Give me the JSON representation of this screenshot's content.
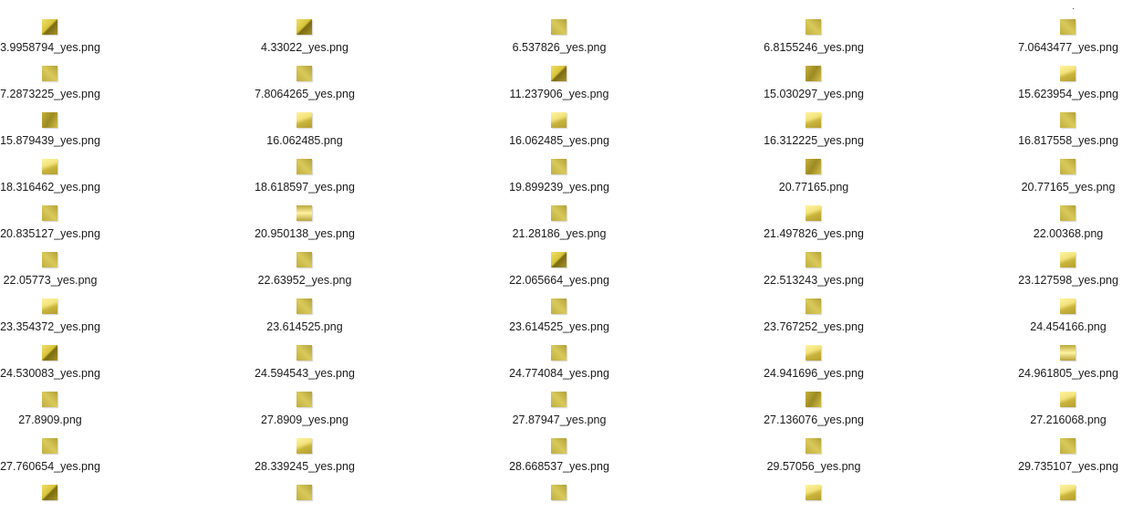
{
  "files": [
    {
      "name": "3.9958794_yes.png",
      "thumb": 0
    },
    {
      "name": "4.33022_yes.png",
      "thumb": 0
    },
    {
      "name": "6.537826_yes.png",
      "thumb": 1
    },
    {
      "name": "6.8155246_yes.png",
      "thumb": 1
    },
    {
      "name": "7.0643477_yes.png",
      "thumb": 1
    },
    {
      "name": "7.2873225_yes.png",
      "thumb": 1
    },
    {
      "name": "7.8064265_yes.png",
      "thumb": 1
    },
    {
      "name": "11.237906_yes.png",
      "thumb": 0
    },
    {
      "name": "15.030297_yes.png",
      "thumb": 3
    },
    {
      "name": "15.623954_yes.png",
      "thumb": 2
    },
    {
      "name": "15.879439_yes.png",
      "thumb": 3
    },
    {
      "name": "16.062485.png",
      "thumb": 2
    },
    {
      "name": "16.062485_yes.png",
      "thumb": 2
    },
    {
      "name": "16.312225_yes.png",
      "thumb": 2
    },
    {
      "name": "16.817558_yes.png",
      "thumb": 1
    },
    {
      "name": "18.316462_yes.png",
      "thumb": 2
    },
    {
      "name": "18.618597_yes.png",
      "thumb": 1
    },
    {
      "name": "19.899239_yes.png",
      "thumb": 1
    },
    {
      "name": "20.77165.png",
      "thumb": 3
    },
    {
      "name": "20.77165_yes.png",
      "thumb": 1
    },
    {
      "name": "20.835127_yes.png",
      "thumb": 1
    },
    {
      "name": "20.950138_yes.png",
      "thumb": 4
    },
    {
      "name": "21.28186_yes.png",
      "thumb": 1
    },
    {
      "name": "21.497826_yes.png",
      "thumb": 2
    },
    {
      "name": "22.00368.png",
      "thumb": 1
    },
    {
      "name": "22.05773_yes.png",
      "thumb": 1
    },
    {
      "name": "22.63952_yes.png",
      "thumb": 1
    },
    {
      "name": "22.065664_yes.png",
      "thumb": 0
    },
    {
      "name": "22.513243_yes.png",
      "thumb": 1
    },
    {
      "name": "23.127598_yes.png",
      "thumb": 2
    },
    {
      "name": "23.354372_yes.png",
      "thumb": 2
    },
    {
      "name": "23.614525.png",
      "thumb": 1
    },
    {
      "name": "23.614525_yes.png",
      "thumb": 1
    },
    {
      "name": "23.767252_yes.png",
      "thumb": 1
    },
    {
      "name": "24.454166.png",
      "thumb": 2
    },
    {
      "name": "24.530083_yes.png",
      "thumb": 0
    },
    {
      "name": "24.594543_yes.png",
      "thumb": 1
    },
    {
      "name": "24.774084_yes.png",
      "thumb": 1
    },
    {
      "name": "24.941696_yes.png",
      "thumb": 2
    },
    {
      "name": "24.961805_yes.png",
      "thumb": 4
    },
    {
      "name": "27.8909.png",
      "thumb": 1
    },
    {
      "name": "27.8909_yes.png",
      "thumb": 1
    },
    {
      "name": "27.87947_yes.png",
      "thumb": 1
    },
    {
      "name": "27.136076_yes.png",
      "thumb": 3
    },
    {
      "name": "27.216068.png",
      "thumb": 2
    },
    {
      "name": "27.760654_yes.png",
      "thumb": 1
    },
    {
      "name": "28.339245_yes.png",
      "thumb": 2
    },
    {
      "name": "28.668537_yes.png",
      "thumb": 1
    },
    {
      "name": "29.57056_yes.png",
      "thumb": 1
    },
    {
      "name": "29.735107_yes.png",
      "thumb": 1
    },
    {
      "name": "",
      "thumb": 0
    },
    {
      "name": "",
      "thumb": 1
    },
    {
      "name": "",
      "thumb": 1
    },
    {
      "name": "",
      "thumb": 2
    },
    {
      "name": "",
      "thumb": 2
    }
  ]
}
